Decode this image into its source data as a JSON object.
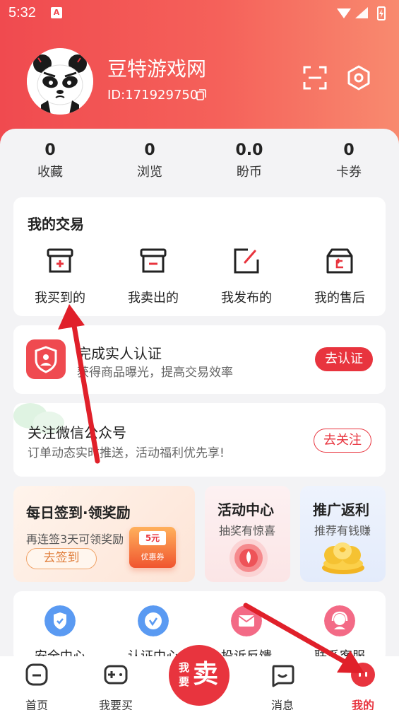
{
  "status": {
    "time": "5:32",
    "notif_letter": "A"
  },
  "profile": {
    "name": "豆特游戏网",
    "id": "ID:171929750"
  },
  "stats": [
    {
      "value": "0",
      "label": "收藏"
    },
    {
      "value": "0",
      "label": "浏览"
    },
    {
      "value": "0.0",
      "label": "盼币"
    },
    {
      "value": "0",
      "label": "卡券"
    }
  ],
  "trade": {
    "title": "我的交易",
    "items": [
      {
        "label": "我买到的",
        "icon": "box-plus-icon"
      },
      {
        "label": "我卖出的",
        "icon": "box-minus-icon"
      },
      {
        "label": "我发布的",
        "icon": "edit-icon"
      },
      {
        "label": "我的售后",
        "icon": "box-return-icon"
      }
    ]
  },
  "verify": {
    "title": "完成实人认证",
    "subtitle": "获得商品曝光，提高交易效率",
    "button": "去认证"
  },
  "wechat": {
    "title": "关注微信公众号",
    "subtitle": "订单动态实时推送，活动福利优先享!",
    "button": "去关注"
  },
  "promos": {
    "checkin": {
      "title": "每日签到·领奖励",
      "subtitle": "再连签3天可领奖励",
      "button": "去签到",
      "coupon_value": "5元",
      "coupon_label": "优惠券"
    },
    "activity": {
      "title": "活动中心",
      "subtitle": "抽奖有惊喜"
    },
    "referral": {
      "title": "推广返利",
      "subtitle": "推荐有钱赚"
    }
  },
  "services": [
    {
      "label": "安全中心",
      "icon": "shield-check-icon"
    },
    {
      "label": "认证中心",
      "icon": "badge-check-icon"
    },
    {
      "label": "投诉反馈",
      "icon": "mail-icon"
    },
    {
      "label": "联系客服",
      "icon": "headset-icon"
    }
  ],
  "tabbar": {
    "tabs": [
      {
        "label": "首页"
      },
      {
        "label": "我要买"
      },
      {
        "label": "消息"
      },
      {
        "label": "我的"
      }
    ],
    "sell_small": "我要",
    "sell_big": "卖"
  },
  "colors": {
    "brand": "#e8343e",
    "header_start": "#f04a4f",
    "header_end": "#f88a6f",
    "arrow": "#e0202a"
  }
}
